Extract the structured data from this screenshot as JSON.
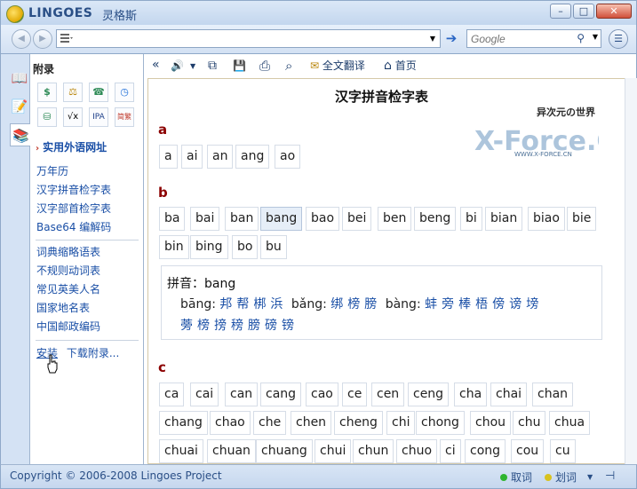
{
  "app": {
    "brand": "LINGOES",
    "brand_cn": "灵格斯"
  },
  "window_controls": {
    "minimize": "–",
    "maximize": "□",
    "close": "✕"
  },
  "nav": {
    "back_glyph": "◀",
    "forward_glyph": "▶",
    "address_value": "",
    "go_glyph": "➔",
    "search_placeholder": "Google",
    "search_icon_glyph": "⚲",
    "dropdown_glyph": "▼",
    "menu_glyph": "☰"
  },
  "tabs": [
    {
      "icon": "📖"
    },
    {
      "icon": "📝"
    },
    {
      "icon": "📚"
    }
  ],
  "sidebar": {
    "title": "附录",
    "icons": [
      {
        "name": "currency-icon",
        "glyph": "$",
        "color": "#2e8b57"
      },
      {
        "name": "scale-icon",
        "glyph": "⚖",
        "color": "#b8860b"
      },
      {
        "name": "phone-icon",
        "glyph": "☎",
        "color": "#2e8b57"
      },
      {
        "name": "clock-icon",
        "glyph": "◷",
        "color": "#1e6fd9"
      },
      {
        "name": "weight-icon",
        "glyph": "⛁",
        "color": "#2e8b57"
      },
      {
        "name": "math-icon",
        "glyph": "√x",
        "color": "#000000"
      },
      {
        "name": "ipa-icon",
        "glyph": "IPA",
        "color": "#1e3f8a"
      },
      {
        "name": "simplified-traditional-icon",
        "glyph": "简繁",
        "color": "#c0392b"
      }
    ],
    "section": "实用外语网址",
    "links_group1": [
      "万年历",
      "汉字拼音检字表",
      "汉字部首检字表",
      "Base64 编解码"
    ],
    "links_group2": [
      "词典缩略语表",
      "不规则动词表",
      "常见英美人名",
      "国家地名表",
      "中国邮政编码"
    ],
    "install": "安装",
    "download": "下载附录..."
  },
  "toolbar": {
    "collapse_glyph": "«",
    "speaker_glyph": "🔊",
    "dropdown_glyph": "▼",
    "copy_glyph": "⧉",
    "save_glyph": "💾",
    "print_glyph": "⎙",
    "find_glyph": "⌕",
    "translate_glyph": "✉",
    "translate_label": "全文翻译",
    "home_glyph": "⌂",
    "home_label": "首页"
  },
  "page": {
    "title": "汉字拼音检字表",
    "watermark_text": "异次元の世界",
    "watermark_brand": "X-Force.CN",
    "watermark_url": "WWW.X-FORCE.CN",
    "groups": [
      {
        "letter": "a",
        "rows": [
          [
            "a",
            "ai",
            "an",
            "ang",
            "ao"
          ]
        ]
      },
      {
        "letter": "b",
        "rows": [
          [
            "ba",
            "bai",
            "ban",
            "bang",
            "bao",
            "bei",
            "ben",
            "beng",
            "bi",
            "bian",
            "biao",
            "bie"
          ],
          [
            "bin",
            "bing",
            "bo",
            "bu"
          ]
        ]
      },
      {
        "letter": "c",
        "rows": [
          [
            "ca",
            "cai",
            "can",
            "cang",
            "cao",
            "ce",
            "cen",
            "ceng",
            "cha",
            "chai",
            "chan"
          ],
          [
            "chang",
            "chao",
            "che",
            "chen",
            "cheng",
            "chi",
            "chong",
            "chou",
            "chu",
            "chua"
          ],
          [
            "chuai",
            "chuan",
            "chuang",
            "chui",
            "chun",
            "chuo",
            "ci",
            "cong",
            "cou",
            "cu"
          ]
        ]
      }
    ],
    "selected": "bang",
    "pinyin": {
      "label": "拼音：bang",
      "line1": [
        {
          "tone": "bāng:",
          "chars": [
            "邦",
            "帮",
            "梆",
            "浜"
          ]
        },
        {
          "tone": "bǎng:",
          "chars": [
            "绑",
            "榜",
            "膀"
          ]
        },
        {
          "tone": "bàng:",
          "chars": [
            "蚌",
            "旁",
            "棒",
            "梧",
            "傍",
            "谤",
            "塝"
          ]
        }
      ],
      "line2": [
        "蒡",
        "榜",
        "搒",
        "䅭",
        "膀",
        "磅",
        "镑"
      ]
    }
  },
  "status": {
    "copyright": "Copyright © 2006-2008 Lingoes Project",
    "pick_word": "取词",
    "highlight_word": "划词",
    "pin_glyph": "⊣",
    "dot_green": "#2fb52f",
    "dot_yellow": "#d8c21f"
  }
}
